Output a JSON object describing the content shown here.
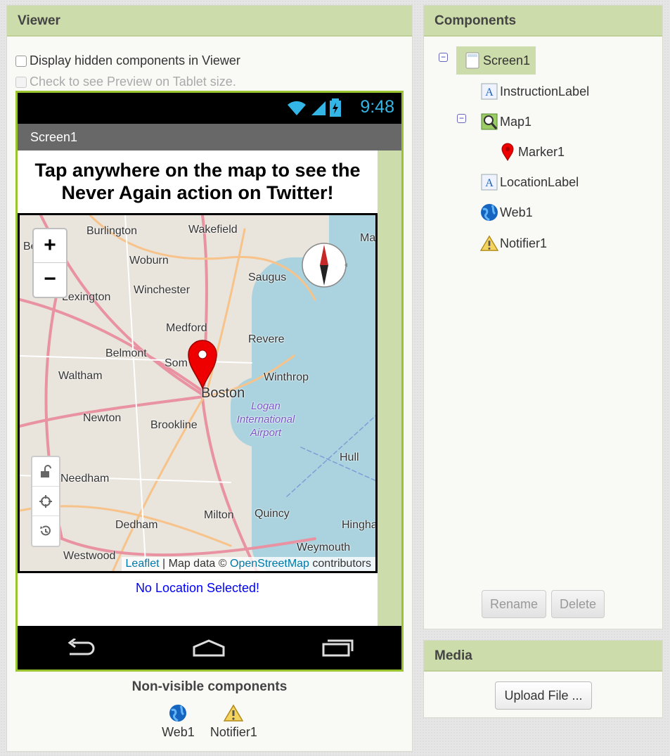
{
  "viewer": {
    "title": "Viewer",
    "display_hidden_label": "Display hidden components in Viewer",
    "tablet_preview_label": "Check to see Preview on Tablet size.",
    "phone": {
      "time": "9:48",
      "screen_title": "Screen1",
      "instruction_text": "Tap anywhere on the map to see the Never Again action on Twitter!",
      "location_label": "No Location Selected!",
      "map": {
        "zoom_in": "+",
        "zoom_out": "−",
        "attribution": {
          "leaflet": "Leaflet",
          "sep": " | Map data © ",
          "osm": "OpenStreetMap",
          "suffix": " contributors"
        },
        "places": {
          "burlington": "Burlington",
          "wakefield": "Wakefield",
          "woburn": "Woburn",
          "saugus": "Saugus",
          "winchester": "Winchester",
          "lexington": "Lexington",
          "medford": "Medford",
          "revere": "Revere",
          "belmont": "Belmont",
          "somerville": "Som",
          "winthrop": "Winthrop",
          "waltham": "Waltham",
          "boston": "Boston",
          "newton": "Newton",
          "brookline": "Brookline",
          "hull": "Hull",
          "needham": "Needham",
          "milton": "Milton",
          "quincy": "Quincy",
          "dedham": "Dedham",
          "hingham": "Hingha",
          "weymouth": "Weymouth",
          "westwood": "Westwood",
          "be": "Be",
          "ma": "Ma",
          "airport": "Logan International Airport"
        }
      }
    },
    "nonvisible_title": "Non-visible components",
    "nonvisible": [
      {
        "label": "Web1",
        "icon": "globe-icon"
      },
      {
        "label": "Notifier1",
        "icon": "warning-icon"
      }
    ]
  },
  "components": {
    "title": "Components",
    "tree": {
      "screen1": "Screen1",
      "instruction_label": "InstructionLabel",
      "map1": "Map1",
      "marker1": "Marker1",
      "location_label": "LocationLabel",
      "web1": "Web1",
      "notifier1": "Notifier1"
    },
    "rename_label": "Rename",
    "delete_label": "Delete"
  },
  "media": {
    "title": "Media",
    "upload_label": "Upload File ..."
  },
  "colors": {
    "header_bg": "#cddcab",
    "phone_border": "#9ac531",
    "status_time": "#33b5e5",
    "location_text": "#0000ff"
  }
}
